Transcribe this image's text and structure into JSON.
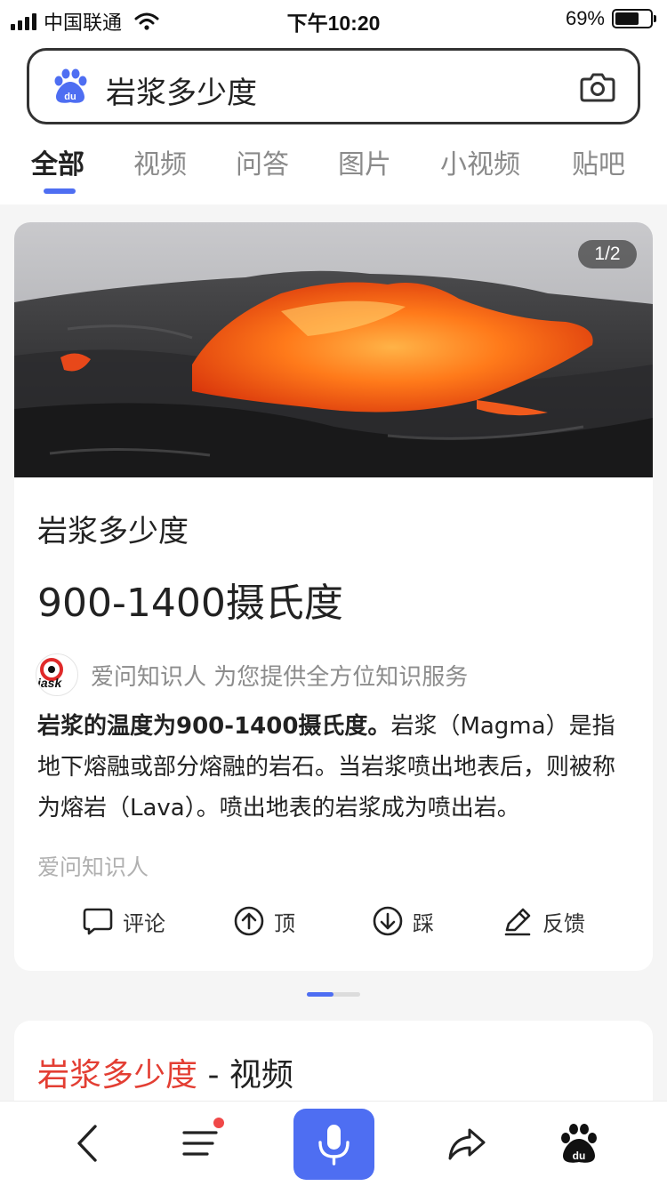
{
  "status_bar": {
    "carrier": "中国联通",
    "time": "下午10:20",
    "battery_percent_text": "69%",
    "battery_level": 0.69
  },
  "search": {
    "query": "岩浆多少度"
  },
  "tabs": [
    {
      "label": "全部",
      "active": true
    },
    {
      "label": "视频",
      "active": false
    },
    {
      "label": "问答",
      "active": false
    },
    {
      "label": "图片",
      "active": false
    },
    {
      "label": "小视频",
      "active": false
    },
    {
      "label": "贴吧",
      "active": false
    }
  ],
  "answer_card": {
    "image_counter": "1/2",
    "title": "岩浆多少度",
    "answer": "900-1400摄氏度",
    "source": {
      "name_line": "爱问知识人 为您提供全方位知识服务",
      "logo_text": "iask"
    },
    "body_bold": "岩浆的温度为900-1400摄氏度。",
    "body_rest": "岩浆（Magma）是指地下熔融或部分熔融的岩石。当岩浆喷出地表后，则被称为熔岩（Lava）。喷出地表的岩浆成为喷出岩。",
    "footer_source": "爱问知识人",
    "actions": {
      "comment": "评论",
      "up": "顶",
      "down": "踩",
      "feedback": "反馈"
    }
  },
  "video_card": {
    "title_highlight": "岩浆多少度",
    "title_suffix": " - 视频"
  },
  "colors": {
    "accent": "#4e6ef2",
    "highlight_red": "#e33e33",
    "notification_dot": "#f04848"
  },
  "icons": {
    "bottom_bar": [
      "back-icon",
      "menu-icon",
      "microphone-icon",
      "share-icon",
      "baidu-paw-icon"
    ]
  }
}
